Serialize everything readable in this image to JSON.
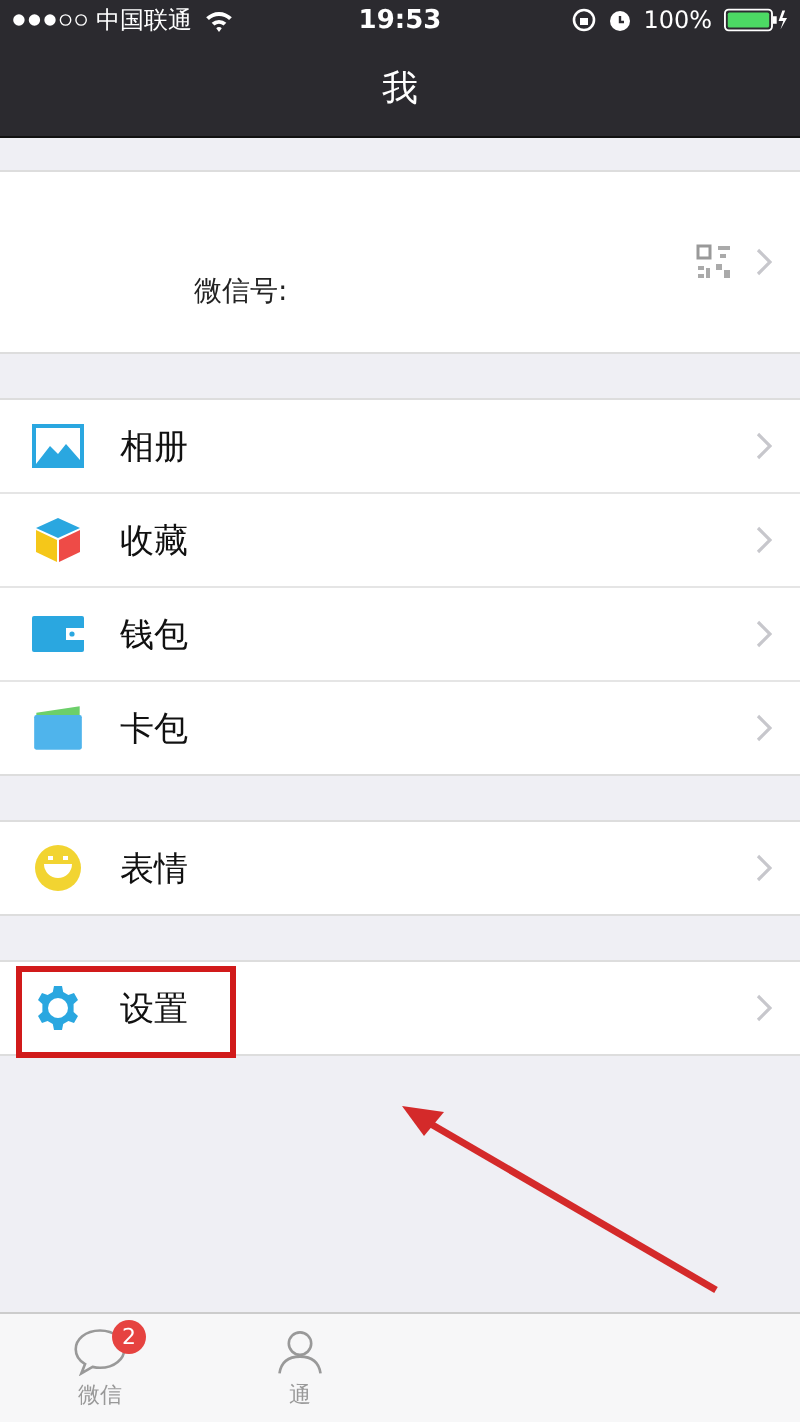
{
  "status_bar": {
    "carrier": "中国联通",
    "time": "19:53",
    "battery": "100%"
  },
  "nav": {
    "title": "我"
  },
  "profile": {
    "wechat_id_label": "微信号:"
  },
  "groups": [
    {
      "items": [
        {
          "kind": "album",
          "label": "相册",
          "highlighted": false
        },
        {
          "kind": "favorites",
          "label": "收藏",
          "highlighted": false
        },
        {
          "kind": "wallet",
          "label": "钱包",
          "highlighted": false
        },
        {
          "kind": "cards",
          "label": "卡包",
          "highlighted": false
        }
      ]
    },
    {
      "items": [
        {
          "kind": "stickers",
          "label": "表情",
          "highlighted": false
        }
      ]
    },
    {
      "items": [
        {
          "kind": "settings",
          "label": "设置",
          "highlighted": true
        }
      ]
    }
  ],
  "tab_bar": [
    {
      "kind": "chats",
      "label": "微信",
      "badge": "2"
    },
    {
      "kind": "contacts",
      "label": "通"
    }
  ]
}
